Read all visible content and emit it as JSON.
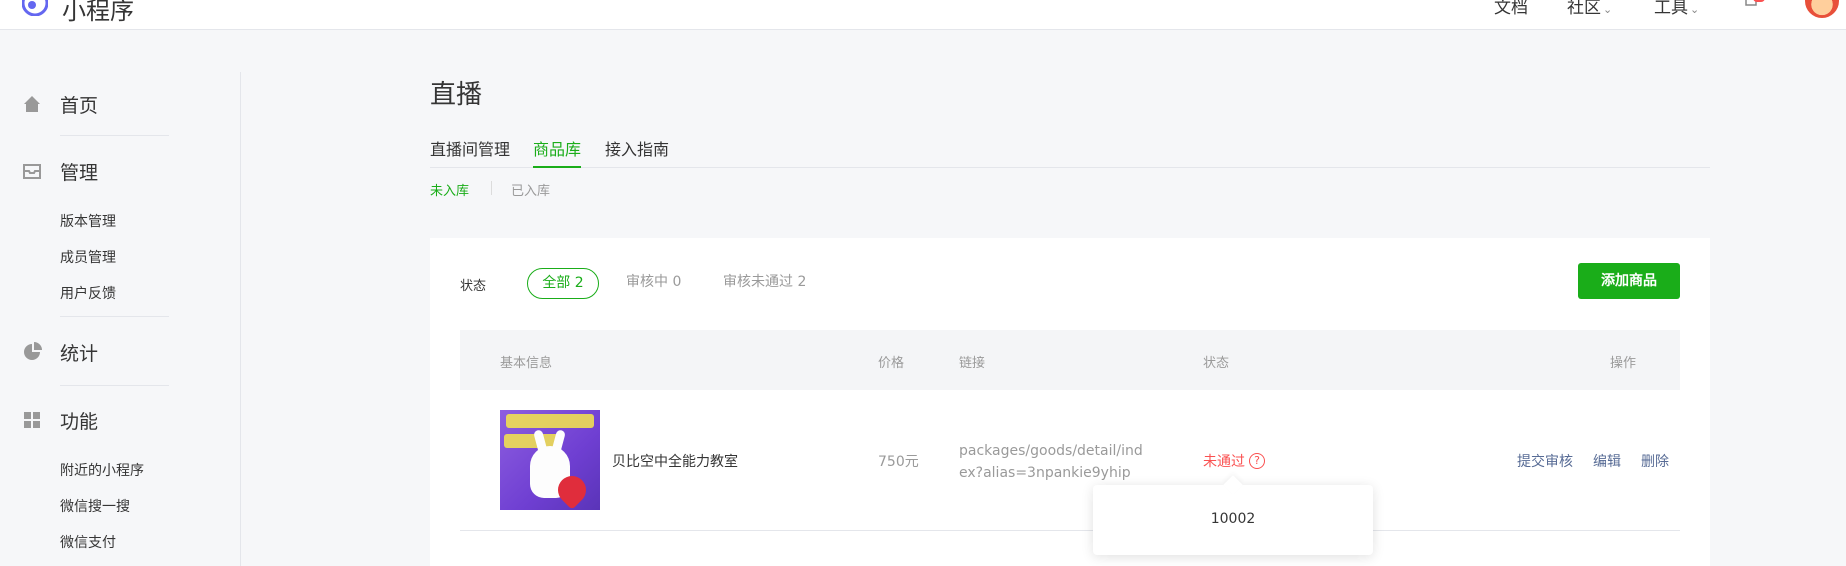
{
  "header": {
    "brand": "小程序",
    "links": [
      {
        "label": "文档",
        "caret": ""
      },
      {
        "label": "社区",
        "caret": "⌄"
      },
      {
        "label": "工具",
        "caret": "⌄"
      }
    ]
  },
  "sidebar": {
    "home": "首页",
    "manage": "管理",
    "manage_items": [
      "版本管理",
      "成员管理",
      "用户反馈"
    ],
    "stats": "统计",
    "features": "功能",
    "feature_items": [
      "附近的小程序",
      "微信搜一搜",
      "微信支付"
    ]
  },
  "page": {
    "title": "直播",
    "tabs": [
      "直播间管理",
      "商品库",
      "接入指南"
    ],
    "active_tab": "商品库",
    "subtabs": [
      "未入库",
      "已入库"
    ],
    "active_subtab": "未入库"
  },
  "filter": {
    "label": "状态",
    "options": [
      "全部 2",
      "审核中 0",
      "审核未通过 2"
    ],
    "add_button": "添加商品"
  },
  "table": {
    "columns": [
      "基本信息",
      "价格",
      "链接",
      "状态",
      "操作"
    ],
    "rows": [
      {
        "name": "贝比空中全能力教室",
        "price": "750元",
        "link": "packages/goods/detail/index?alias=3npankie9yhip",
        "status": "未通过",
        "status_help": "?",
        "actions": [
          "提交审核",
          "编辑",
          "删除"
        ]
      }
    ]
  },
  "tooltip": {
    "text": "10002"
  },
  "colors": {
    "accent": "#1aad19",
    "error": "#fa5151",
    "link": "#576b95"
  }
}
